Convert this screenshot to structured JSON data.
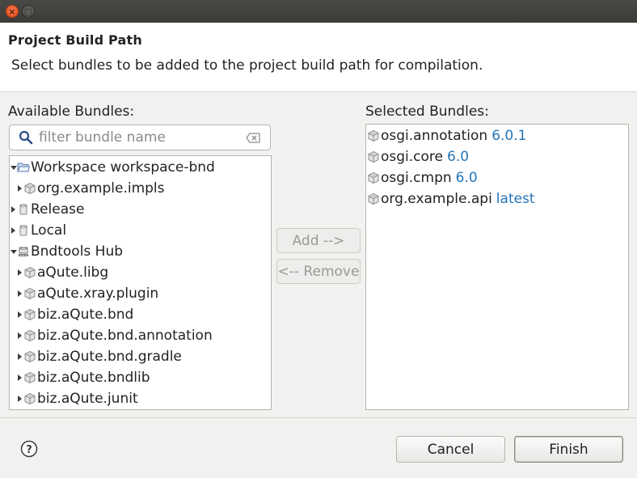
{
  "window": {
    "close_glyph": "×",
    "max_glyph": "□"
  },
  "header": {
    "title": "Project Build Path",
    "description": "Select bundles to be added to the project build path for compilation."
  },
  "available": {
    "label": "Available Bundles:",
    "filter_placeholder": "filter bundle name",
    "filter_value": "",
    "tree": [
      {
        "label": "Workspace workspace-bnd",
        "expanded": true,
        "icon": "folder-icon",
        "level": 0
      },
      {
        "label": "org.example.impls",
        "expanded": false,
        "icon": "bundle-icon",
        "level": 1
      },
      {
        "label": "Release",
        "expanded": false,
        "icon": "repository-icon",
        "level": 0
      },
      {
        "label": "Local",
        "expanded": false,
        "icon": "repository-icon",
        "level": 0
      },
      {
        "label": "Bndtools Hub",
        "expanded": true,
        "icon": "remote-repository-icon",
        "level": 0
      },
      {
        "label": "aQute.libg",
        "expanded": false,
        "icon": "bundle-icon",
        "level": 1
      },
      {
        "label": "aQute.xray.plugin",
        "expanded": false,
        "icon": "bundle-icon",
        "level": 1
      },
      {
        "label": "biz.aQute.bnd",
        "expanded": false,
        "icon": "bundle-icon",
        "level": 1
      },
      {
        "label": "biz.aQute.bnd.annotation",
        "expanded": false,
        "icon": "bundle-icon",
        "level": 1
      },
      {
        "label": "biz.aQute.bnd.gradle",
        "expanded": false,
        "icon": "bundle-icon",
        "level": 1
      },
      {
        "label": "biz.aQute.bndlib",
        "expanded": false,
        "icon": "bundle-icon",
        "level": 1
      },
      {
        "label": "biz.aQute.junit",
        "expanded": false,
        "icon": "bundle-icon",
        "level": 1
      }
    ]
  },
  "actions": {
    "add_label": "Add -->",
    "remove_label": "<-- Remove"
  },
  "selected": {
    "label": "Selected Bundles:",
    "items": [
      {
        "name": "osgi.annotation",
        "version": "6.0.1",
        "icon": "bundle-icon"
      },
      {
        "name": "osgi.core",
        "version": "6.0",
        "icon": "bundle-icon"
      },
      {
        "name": "osgi.cmpn",
        "version": "6.0",
        "icon": "bundle-icon"
      },
      {
        "name": "org.example.api",
        "version": "latest",
        "icon": "bundle-icon"
      }
    ]
  },
  "footer": {
    "help_glyph": "?",
    "cancel_label": "Cancel",
    "finish_label": "Finish"
  },
  "colors": {
    "version_text": "#2475b6",
    "close_button": "#df4a16",
    "titlebar": "#3c3b37"
  }
}
